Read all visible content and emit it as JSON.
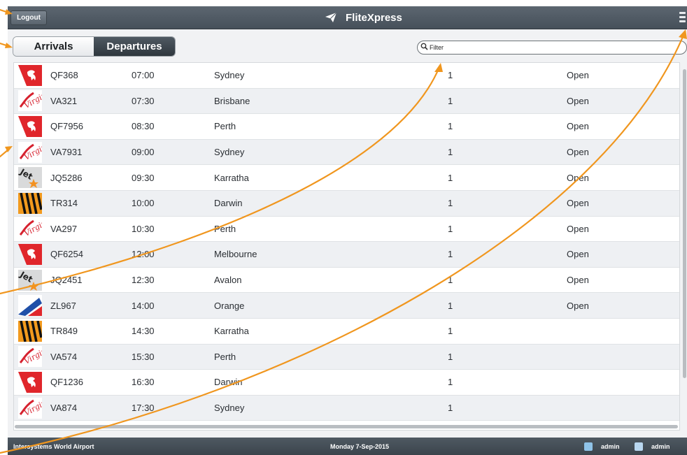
{
  "header": {
    "logout_label": "Logout",
    "brand_title": "FliteXpress",
    "brand_icon": "paper-plane-icon",
    "menu_icon": "menu-icon"
  },
  "tabs": [
    {
      "label": "Arrivals",
      "selected": false
    },
    {
      "label": "Departures",
      "selected": true
    }
  ],
  "filter": {
    "placeholder": "Filter",
    "value": ""
  },
  "rows": [
    {
      "airline": "qantas",
      "flight": "QF368",
      "time": "07:00",
      "destination": "Sydney",
      "gate": "1",
      "status": "Open"
    },
    {
      "airline": "virgin",
      "flight": "VA321",
      "time": "07:30",
      "destination": "Brisbane",
      "gate": "1",
      "status": "Open"
    },
    {
      "airline": "qantas",
      "flight": "QF7956",
      "time": "08:30",
      "destination": "Perth",
      "gate": "1",
      "status": "Open"
    },
    {
      "airline": "virgin",
      "flight": "VA7931",
      "time": "09:00",
      "destination": "Sydney",
      "gate": "1",
      "status": "Open"
    },
    {
      "airline": "jetstar",
      "flight": "JQ5286",
      "time": "09:30",
      "destination": "Karratha",
      "gate": "1",
      "status": "Open"
    },
    {
      "airline": "tigerair",
      "flight": "TR314",
      "time": "10:00",
      "destination": "Darwin",
      "gate": "1",
      "status": "Open"
    },
    {
      "airline": "virgin",
      "flight": "VA297",
      "time": "10:30",
      "destination": "Perth",
      "gate": "1",
      "status": "Open"
    },
    {
      "airline": "qantas",
      "flight": "QF6254",
      "time": "12:00",
      "destination": "Melbourne",
      "gate": "1",
      "status": "Open"
    },
    {
      "airline": "jetstar",
      "flight": "JQ2451",
      "time": "12:30",
      "destination": "Avalon",
      "gate": "1",
      "status": "Open"
    },
    {
      "airline": "rex",
      "flight": "ZL967",
      "time": "14:00",
      "destination": "Orange",
      "gate": "1",
      "status": "Open"
    },
    {
      "airline": "tigerair",
      "flight": "TR849",
      "time": "14:30",
      "destination": "Karratha",
      "gate": "1",
      "status": ""
    },
    {
      "airline": "virgin",
      "flight": "VA574",
      "time": "15:30",
      "destination": "Perth",
      "gate": "1",
      "status": ""
    },
    {
      "airline": "qantas",
      "flight": "QF1236",
      "time": "16:30",
      "destination": "Darwin",
      "gate": "1",
      "status": ""
    },
    {
      "airline": "virgin",
      "flight": "VA874",
      "time": "17:30",
      "destination": "Sydney",
      "gate": "1",
      "status": ""
    }
  ],
  "footer": {
    "airport": "Intersystems World Airport",
    "date": "Monday 7-Sep-2015",
    "user1": "admin",
    "user2": "admin"
  },
  "colors": {
    "header": "#4f5962",
    "annotation_orange": "#f0961e",
    "qantas_red": "#e0262b",
    "rex_blue": "#1f4fa8"
  }
}
